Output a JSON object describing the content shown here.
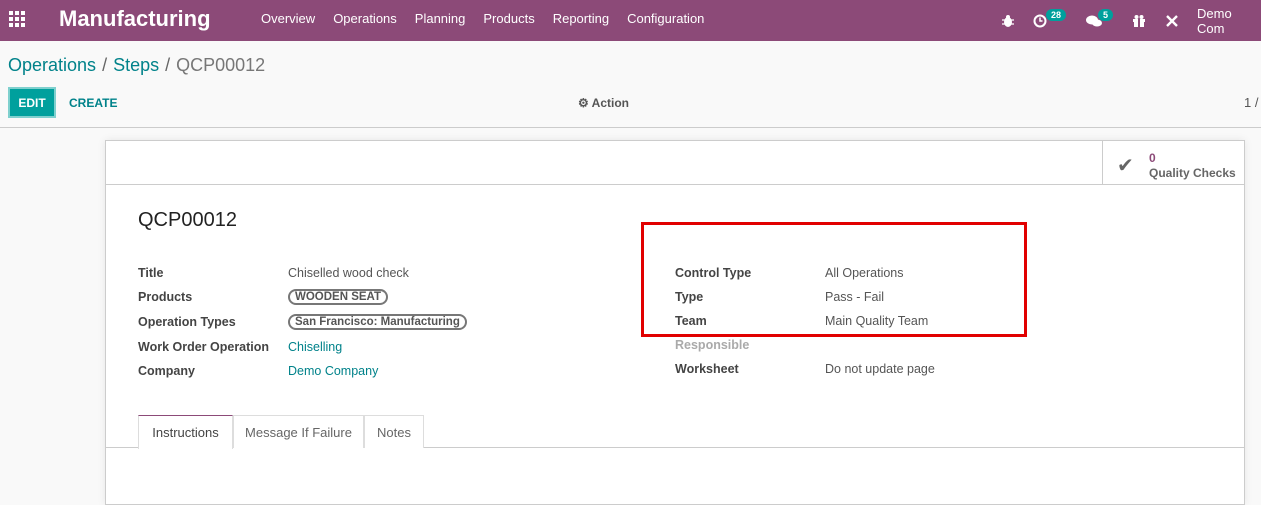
{
  "navbar": {
    "app_title": "Manufacturing",
    "menu": [
      "Overview",
      "Operations",
      "Planning",
      "Products",
      "Reporting",
      "Configuration"
    ],
    "activity_count": "28",
    "message_count": "5",
    "company": "Demo Com",
    "icons": [
      "apps-grid-icon",
      "bug-icon",
      "activity-clock-icon",
      "chat-icon",
      "gift-icon",
      "tools-icon"
    ]
  },
  "breadcrumb": {
    "items": [
      "Operations",
      "Steps"
    ],
    "current": "QCP00012",
    "separator": "/"
  },
  "controls": {
    "edit": "EDIT",
    "create": "CREATE",
    "action": "Action",
    "pager": "1 /"
  },
  "smart_button": {
    "count": "0",
    "label": "Quality Checks"
  },
  "record": {
    "name": "QCP00012",
    "left_fields": [
      {
        "label": "Title",
        "value": "Chiselled wood check"
      },
      {
        "label": "Products",
        "value": "WOODEN SEAT"
      },
      {
        "label": "Operation Types",
        "value": "San Francisco: Manufacturing"
      },
      {
        "label": "Work Order Operation",
        "value": "Chiselling"
      },
      {
        "label": "Company",
        "value": "Demo Company"
      }
    ],
    "right_fields": [
      {
        "label": "Control Type",
        "value": "All Operations"
      },
      {
        "label": "Type",
        "value": "Pass - Fail"
      },
      {
        "label": "Team",
        "value": "Main Quality Team"
      },
      {
        "label": "Responsible",
        "value": ""
      },
      {
        "label": "Worksheet",
        "value": "Do not update page"
      }
    ]
  },
  "tabs": [
    "Instructions",
    "Message If Failure",
    "Notes"
  ],
  "colors": {
    "brand": "#8c4a78",
    "accent": "#00a09d",
    "link": "#00828a",
    "highlight": "#e10000"
  }
}
